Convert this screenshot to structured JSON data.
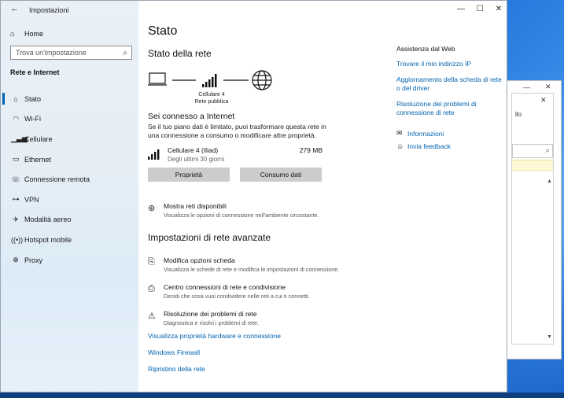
{
  "window": {
    "title": "Impostazioni",
    "controls": [
      "—",
      "☐",
      "✕"
    ]
  },
  "sidebar": {
    "home": "Home",
    "search_placeholder": "Trova un'impostazione",
    "section": "Rete e Internet",
    "items": [
      {
        "label": "Stato",
        "icon": "home-network-icon",
        "active": true
      },
      {
        "label": "Wi-Fi",
        "icon": "wifi-icon",
        "active": false
      },
      {
        "label": "Cellulare",
        "icon": "cellular-icon",
        "active": false
      },
      {
        "label": "Ethernet",
        "icon": "ethernet-icon",
        "active": false
      },
      {
        "label": "Connessione remota",
        "icon": "dialup-icon",
        "active": false
      },
      {
        "label": "VPN",
        "icon": "vpn-icon",
        "active": false
      },
      {
        "label": "Modalità aereo",
        "icon": "airplane-icon",
        "active": false
      },
      {
        "label": "Hotspot mobile",
        "icon": "hotspot-icon",
        "active": false
      },
      {
        "label": "Proxy",
        "icon": "globe-icon",
        "active": false
      }
    ]
  },
  "main": {
    "title": "Stato",
    "network_status_heading": "Stato della rete",
    "diagram_label_line1": "Cellulare 4",
    "diagram_label_line2": "Rete pubblica",
    "connected_title": "Sei connesso a Internet",
    "connected_desc": "Se il tuo piano dati è limitato, puoi trasformare questa rete in una connessione a consumo o modificare altre proprietà.",
    "connection": {
      "name": "Cellulare 4 (Iliad)",
      "sub": "Degli ultimi 30 giorni",
      "usage": "279 MB"
    },
    "buttons": {
      "properties": "Proprietà",
      "data_usage": "Consumo dati"
    },
    "show_networks": {
      "title": "Mostra reti disponibili",
      "desc": "Visualizza le opzioni di connessione nell'ambiente circostante."
    },
    "advanced_heading": "Impostazioni di rete avanzate",
    "advanced": [
      {
        "title": "Modifica opzioni scheda",
        "desc": "Visualizza le schede di rete e modifica le impostazioni di connessione."
      },
      {
        "title": "Centro connessioni di rete e condivisione",
        "desc": "Decidi che cosa vuoi condividere nelle reti a cui ti connetti."
      },
      {
        "title": "Risoluzione dei problemi di rete",
        "desc": "Diagnostica e risolvi i problemi di rete."
      }
    ],
    "links": [
      "Visualizza proprietà hardware e connessione",
      "Windows Firewall",
      "Ripristino della rete"
    ]
  },
  "help": {
    "heading": "Assistenza dal Web",
    "links": [
      "Trovare il mio indirizzo IP",
      "Aggiornamento della scheda di rete o del driver",
      "Risoluzione dei problemi di connessione di rete"
    ],
    "info": "Informazioni",
    "feedback": "Invia feedback"
  },
  "background_window": {
    "text_fragment": "llo"
  }
}
